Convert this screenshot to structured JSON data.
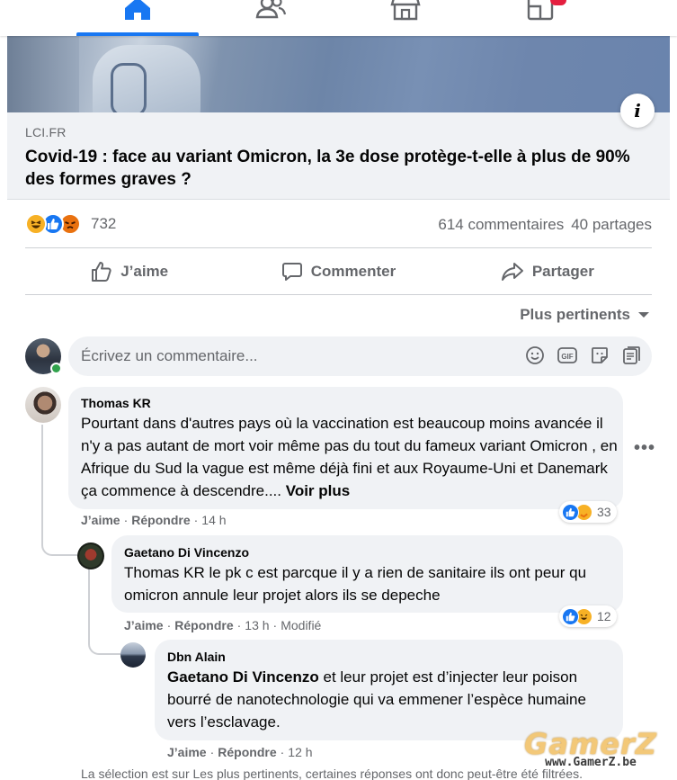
{
  "nav": {
    "items": [
      {
        "name": "home",
        "icon": "home-icon",
        "active": true
      },
      {
        "name": "friends",
        "icon": "friends-icon",
        "active": false
      },
      {
        "name": "marketplace",
        "icon": "marketplace-icon",
        "active": false
      },
      {
        "name": "pages",
        "icon": "pages-icon",
        "active": false
      }
    ],
    "accent_color": "#1877f2"
  },
  "post": {
    "info_icon": "i",
    "link_source": "LCI.FR",
    "link_title": "Covid-19 : face au variant Omicron, la 3e dose protège-t-elle à plus de 90% des formes graves ?",
    "reactions": [
      "haha",
      "like",
      "angry"
    ],
    "reaction_count": "732",
    "comments_count": "614 commentaires",
    "shares_count": "40 partages",
    "actions": {
      "like": "J’aime",
      "comment": "Commenter",
      "share": "Partager"
    },
    "sort_label": "Plus pertinents",
    "comment_placeholder": "Écrivez un commentaire..."
  },
  "comments": [
    {
      "author": "Thomas KR",
      "text": "Pourtant dans d'autres pays où la vaccination est beaucoup moins avancée il n'y a pas autant de mort voir même pas du tout du fameux variant Omicron , en Afrique du Sud la vague est même déjà fini et aux Royaume-Uni et Danemark ça commence à descendre....",
      "see_more": "Voir plus",
      "like_label": "J’aime",
      "reply_label": "Répondre",
      "time": "14 h",
      "reaction_count": "33"
    },
    {
      "author": "Gaetano Di Vincenzo",
      "text": "Thomas KR le pk c est parcque il y a rien de sanitaire ils ont peur qu omicron annule leur projet alors ils se depeche",
      "like_label": "J’aime",
      "reply_label": "Répondre",
      "time": "13 h",
      "edited": "Modifié",
      "reaction_count": "12"
    },
    {
      "author": "Dbn Alain",
      "mention": "Gaetano Di Vincenzo",
      "text": " et leur projet est d’injecter leur poison bourré de nanotechnologie qui va emmener l’espèce humaine vers l’esclavage.",
      "like_label": "J’aime",
      "reply_label": "Répondre",
      "time": "12 h"
    }
  ],
  "footer_note": "La sélection est sur Les plus pertinents, certaines réponses ont donc peut-être été filtrées.",
  "watermark": {
    "logo": "GamerZ",
    "url": "www.GamerZ.be"
  }
}
